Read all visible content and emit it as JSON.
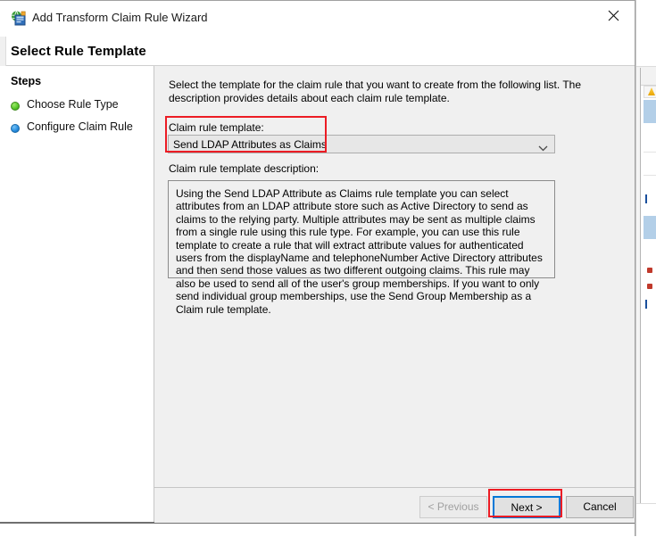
{
  "window": {
    "title": "Add Transform Claim Rule Wizard",
    "icon": "claim-rule-wizard-icon",
    "close_icon": "close-icon",
    "page_title": "Select Rule Template"
  },
  "sidebar": {
    "heading": "Steps",
    "items": [
      {
        "label": "Choose Rule Type",
        "bullet_color": "#58c92c",
        "state": "completed"
      },
      {
        "label": "Configure Claim Rule",
        "bullet_color": "#2a8fe0",
        "state": "current"
      }
    ]
  },
  "main": {
    "instructions": "Select the template for the claim rule that you want to create from the following list. The description provides details about each claim rule template.",
    "template_label": "Claim rule template:",
    "template_selected": "Send LDAP Attributes as Claims",
    "template_arrow_icon": "chevron-down-icon",
    "description_label": "Claim rule template description:",
    "description_text": "Using the Send LDAP Attribute as Claims rule template you can select attributes from an LDAP attribute store such as Active Directory to send as claims to the relying party. Multiple attributes may be sent as multiple claims from a single rule using this rule type. For example, you can use this rule template to create a rule that will extract attribute values for authenticated users from the displayName and telephoneNumber Active Directory attributes and then send those values as two different outgoing claims. This rule may also be used to send all of the user's group memberships. If you want to only send individual group memberships, use the Send Group Membership as a Claim rule template."
  },
  "footer": {
    "previous_label": "< Previous",
    "previous_disabled": true,
    "next_label": "Next >",
    "next_focused": true,
    "cancel_label": "Cancel"
  },
  "annotations": {
    "accent_color": "#ec1c24",
    "focus_color": "#0078d7",
    "highlighted": [
      "claim-rule-template-combobox",
      "next-button"
    ]
  }
}
